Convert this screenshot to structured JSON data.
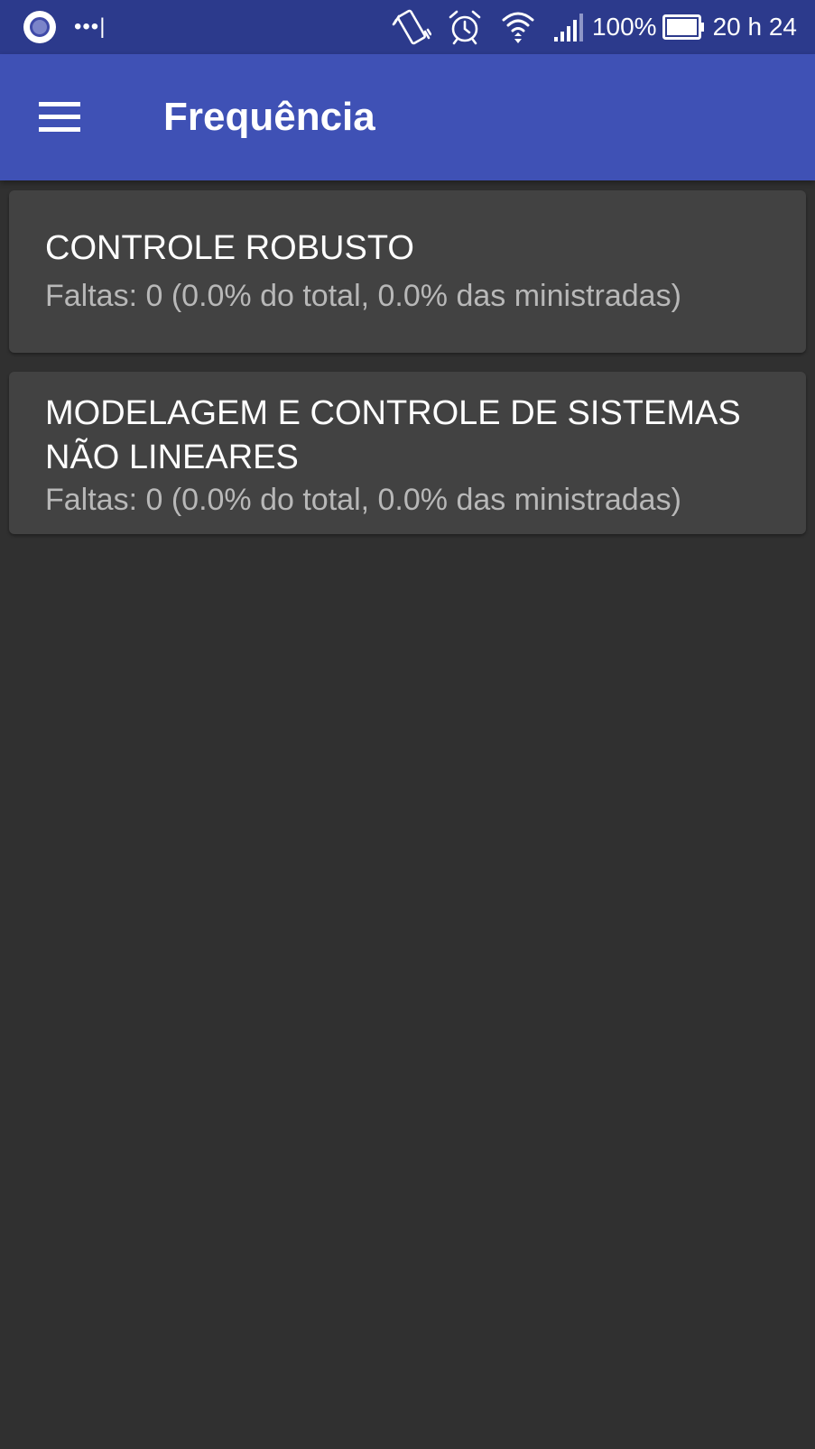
{
  "status_bar": {
    "battery_percent_text": "100%",
    "time": "20 h 24",
    "notification_dots": "•••|",
    "icons": [
      "app-notification-icon",
      "vibrate-icon",
      "alarm-icon",
      "wifi-icon",
      "signal-icon",
      "battery-icon"
    ]
  },
  "app_bar": {
    "title": "Frequência",
    "menu_icon": "menu-icon",
    "background_color": "#3f51b5"
  },
  "courses": [
    {
      "name": "CONTROLE ROBUSTO",
      "absences": "Faltas: 0 (0.0% do total, 0.0% das ministradas)"
    },
    {
      "name": "MODELAGEM E CONTROLE DE SISTEMAS NÃO LINEARES",
      "absences": "Faltas: 0 (0.0% do total, 0.0% das ministradas)"
    }
  ],
  "colors": {
    "background": "#303030",
    "card": "#424242",
    "status_bar": "#2c3a8c"
  }
}
